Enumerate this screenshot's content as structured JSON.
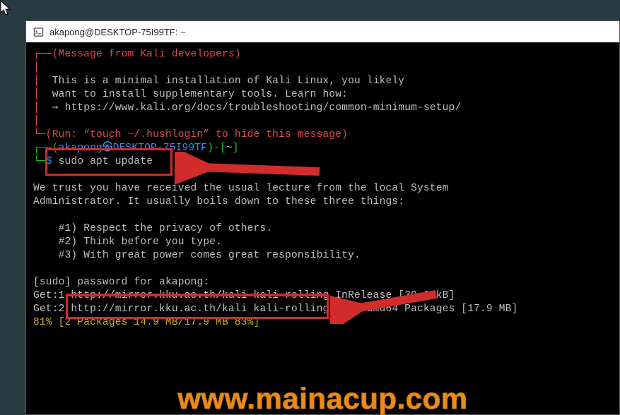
{
  "titlebar": {
    "title": "akapong@DESKTOP-75I99TF: ~"
  },
  "term": {
    "box_open": "┌──(",
    "msg_header": "Message from Kali developers",
    "box_close": ")",
    "pipe": "│",
    "msg_l1": "This is a minimal installation of Kali Linux, you likely",
    "msg_l2": "want to install supplementary tools. Learn how:",
    "msg_l3_prefix": "⇒ ",
    "msg_l3_url": "https://www.kali.org/docs/troubleshooting/common-minimum-setup/",
    "box_bottom": "└─(Run: “touch ~/.hushlogin” to hide this message)",
    "prompt_open": "┌──(",
    "prompt_user": "akapong㉿",
    "prompt_host": "DESKTOP-75I99TF",
    "prompt_mid": ")-[",
    "prompt_path": "~",
    "prompt_close": "]",
    "prompt_line2": "└─",
    "prompt_dollar": "$",
    "command": " sudo apt update",
    "blank": "",
    "lecture_l1": "We trust you have received the usual lecture from the local System",
    "lecture_l2": "Administrator. It usually boils down to these three things:",
    "lecture_r1": "    #1) Respect the privacy of others.",
    "lecture_r2": "    #2) Think before you type.",
    "lecture_r3": "    #3) With great power comes great responsibility.",
    "sudo_label": "[sudo]",
    "sudo_rest": " password for akapong:",
    "get1": "Get:1 http://mirror.kku.ac.th/kali kali-rolling InRelease [30.6 kB]",
    "get2": "Get:2 http://mirror.kku.ac.th/kali kali-rolling/main amd64 Packages [17.9 MB]",
    "progress": "81% [2 Packages 14.9 MB/17.9 MB 83%]"
  },
  "watermark": "www.mainacup.com"
}
